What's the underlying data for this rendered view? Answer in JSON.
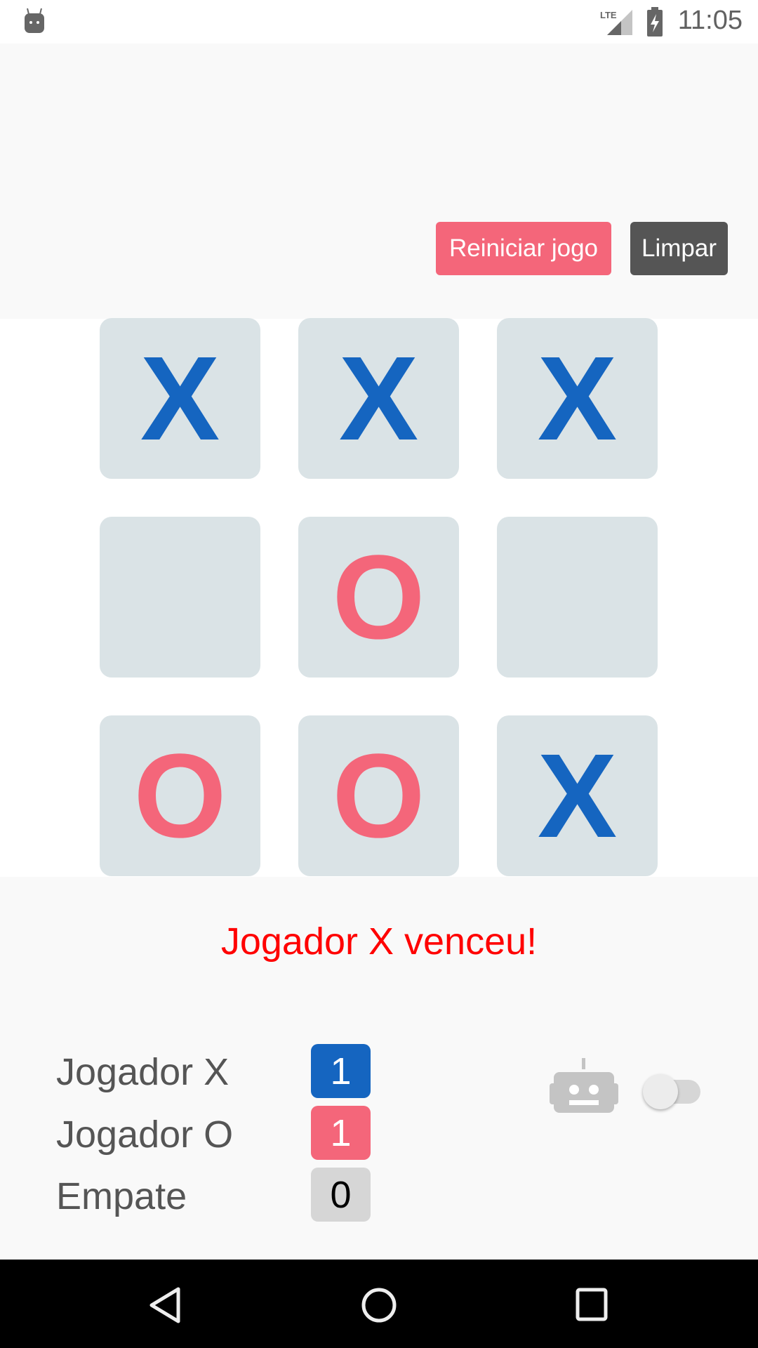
{
  "status_bar": {
    "time": "11:05",
    "network": "LTE"
  },
  "toolbar": {
    "restart_label": "Reiniciar jogo",
    "clear_label": "Limpar",
    "restart_color": "#f4667a",
    "clear_color": "#555555"
  },
  "board": {
    "cells": [
      "X",
      "X",
      "X",
      "",
      "O",
      "",
      "O",
      "O",
      "X"
    ],
    "x_color": "#1565c0",
    "o_color": "#f4667a"
  },
  "message": "Jogador X venceu!",
  "score": {
    "rows": [
      {
        "label": "Jogador X",
        "value": "1"
      },
      {
        "label": "Jogador O",
        "value": "1"
      },
      {
        "label": "Empate",
        "value": "0"
      }
    ]
  },
  "ai_toggle": {
    "icon": "robot-icon",
    "on": false
  }
}
